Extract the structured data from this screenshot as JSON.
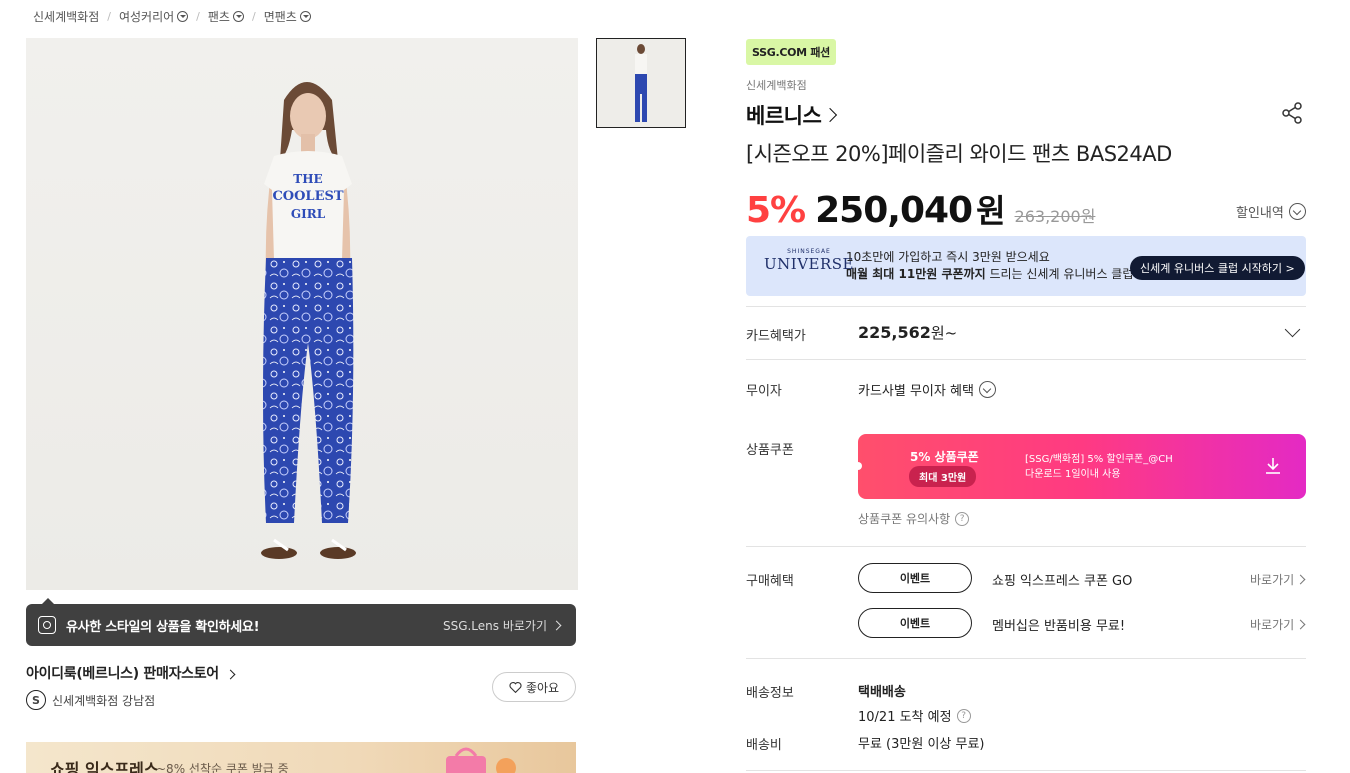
{
  "breadcrumb": [
    {
      "label": "신세계백화점",
      "dropdown": false
    },
    {
      "label": "여성커리어",
      "dropdown": true
    },
    {
      "label": "팬츠",
      "dropdown": true
    },
    {
      "label": "면팬츠",
      "dropdown": true
    }
  ],
  "product_image": {
    "shirt_text": [
      "THE",
      "COOLEST",
      "GIRL"
    ]
  },
  "lens": {
    "text": "유사한 스타일의 상품을 확인하세요!",
    "link": "SSG.Lens 바로가기"
  },
  "store": {
    "name": "아이디룩(베르니스) 판매자스토어",
    "badge": "S",
    "branch": "신세계백화점 강남점",
    "like_label": "좋아요"
  },
  "express_banner": {
    "title": "쇼핑 익스프레스",
    "subtitle": "~8% 선착순 쿠폰 발급 중"
  },
  "product": {
    "badge": "SSG.COM 패션",
    "dept": "신세계백화점",
    "brand": "베르니스",
    "title": "[시즌오프 20%]페이즐리 와이드 팬츠 BAS24AD",
    "discount": "5%",
    "price": "250,040",
    "currency": "원",
    "original_price": "263,200원",
    "discount_detail": "할인내역"
  },
  "universe": {
    "logo_small": "SHINSEGAE",
    "logo_big": "UNIVERSE",
    "line1": "10초만에 가입하고 즉시 3만원 받으세요",
    "line2_bold": "매월 최대 11만원 쿠폰까지",
    "line2_rest": " 드리는 신세계 유니버스 클럽",
    "button": "신세계 유니버스 클럽 시작하기 >"
  },
  "card": {
    "label": "카드혜택가",
    "price": "225,562",
    "suffix": "원~"
  },
  "installment": {
    "label": "무이자",
    "value": "카드사별 무이자 혜택"
  },
  "coupon": {
    "label": "상품쿠폰",
    "title": "5% 상품쿠폰",
    "max": "최대 3만원",
    "desc1": "[SSG/백화점] 5% 할인쿠폰_@CH",
    "desc2": "다운로드 1일이내 사용",
    "note": "상품쿠폰 유의사항"
  },
  "benefits": {
    "label": "구매혜택",
    "items": [
      {
        "button": "이벤트",
        "text": "쇼핑 익스프레스 쿠폰 GO",
        "link": "바로가기"
      },
      {
        "button": "이벤트",
        "text": "멤버십은 반품비용 무료!",
        "link": "바로가기"
      }
    ]
  },
  "shipping": {
    "label": "배송정보",
    "method": "택배배송",
    "eta": "10/21 도착 예정"
  },
  "shipping_fee": {
    "label": "배송비",
    "value": "무료 (3만원 이상 무료)"
  },
  "colors": {
    "discount": "#ff4141",
    "badge_bg": "#d9f7a5",
    "coupon_start": "#ff4f6c",
    "coupon_end": "#e42ac4"
  }
}
